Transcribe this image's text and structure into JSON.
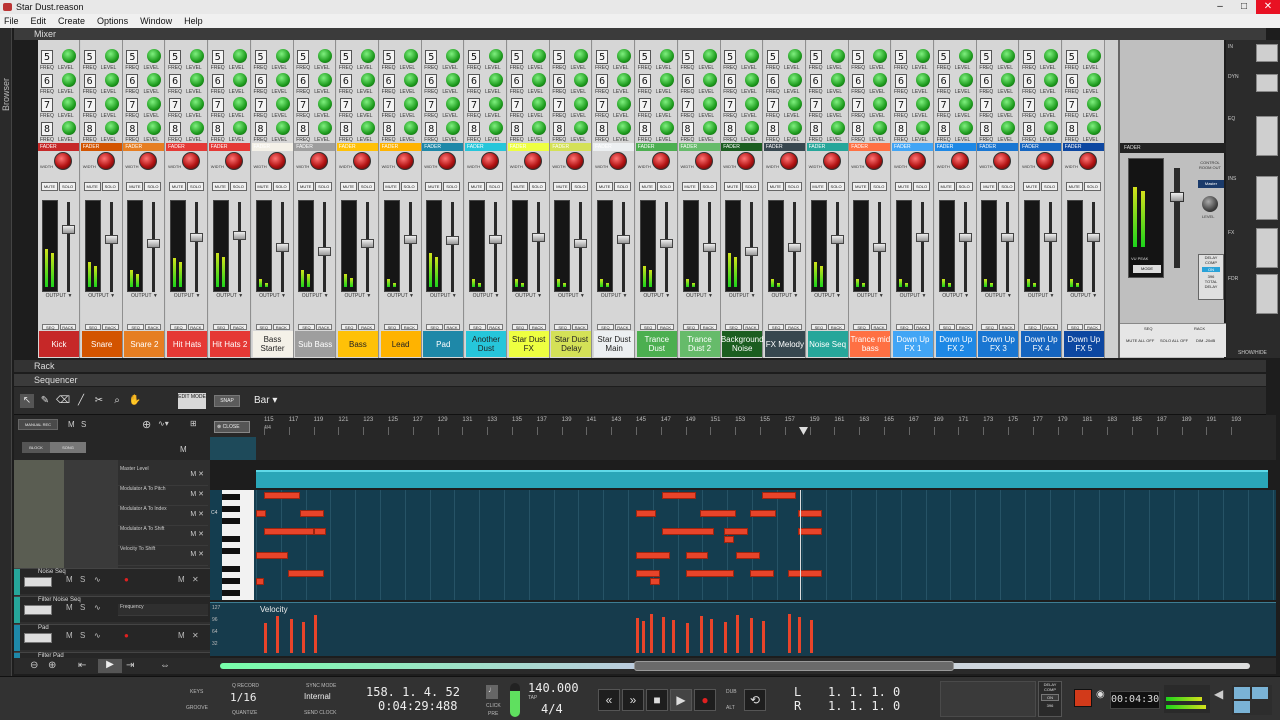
{
  "window": {
    "title": "Star Dust.reason",
    "minimize": "–",
    "maximize": "□",
    "close": "✕"
  },
  "menu": [
    "File",
    "Edit",
    "Create",
    "Options",
    "Window",
    "Help"
  ],
  "browser_label": "Browser",
  "mixer_label": "Mixer",
  "rack_label": "Rack",
  "sequencer_label": "Sequencer",
  "channels": [
    {
      "name": "Kick",
      "color": "#c62828",
      "meter": 0.45,
      "fader": 0.72
    },
    {
      "name": "Snare",
      "color": "#d35400",
      "meter": 0.3,
      "fader": 0.6
    },
    {
      "name": "Snare 2",
      "color": "#e67e22",
      "meter": 0.2,
      "fader": 0.55
    },
    {
      "name": "Hit Hats",
      "color": "#e53935",
      "meter": 0.35,
      "fader": 0.62
    },
    {
      "name": "Hit Hats 2",
      "color": "#e53935",
      "meter": 0.4,
      "fader": 0.65
    },
    {
      "name": "Bass Starter",
      "color": "#f4f1e8",
      "meter": 0.1,
      "fader": 0.5
    },
    {
      "name": "Sub Bass",
      "color": "#9e9e9e",
      "meter": 0.2,
      "fader": 0.45
    },
    {
      "name": "Bass",
      "color": "#ffc107",
      "meter": 0.15,
      "fader": 0.55
    },
    {
      "name": "Lead",
      "color": "#ffb300",
      "meter": 0.1,
      "fader": 0.6
    },
    {
      "name": "Pad",
      "color": "#1e88a8",
      "meter": 0.4,
      "fader": 0.58
    },
    {
      "name": "Another Dust",
      "color": "#26c6da",
      "meter": 0.1,
      "fader": 0.6
    },
    {
      "name": "Star Dust FX",
      "color": "#eeff41",
      "meter": 0.1,
      "fader": 0.62
    },
    {
      "name": "Star Dust Delay",
      "color": "#d4e157",
      "meter": 0.1,
      "fader": 0.55
    },
    {
      "name": "Star Dust Main",
      "color": "#eceff1",
      "meter": 0.1,
      "fader": 0.6
    },
    {
      "name": "Trance Dust",
      "color": "#4caf50",
      "meter": 0.25,
      "fader": 0.55
    },
    {
      "name": "Trance Dust 2",
      "color": "#66bb6a",
      "meter": 0.1,
      "fader": 0.5
    },
    {
      "name": "Background Noise",
      "color": "#1b5e20",
      "meter": 0.4,
      "fader": 0.45
    },
    {
      "name": "FX Melody",
      "color": "#37474f",
      "meter": 0.1,
      "fader": 0.5
    },
    {
      "name": "Noise Seq",
      "color": "#26a69a",
      "meter": 0.3,
      "fader": 0.6
    },
    {
      "name": "Trance mid bass",
      "color": "#ff7043",
      "meter": 0.1,
      "fader": 0.5
    },
    {
      "name": "Down Up FX 1",
      "color": "#42a5f5",
      "meter": 0.1,
      "fader": 0.62
    },
    {
      "name": "Down Up FX 2",
      "color": "#1e88e5",
      "meter": 0.1,
      "fader": 0.62
    },
    {
      "name": "Down Up FX 3",
      "color": "#1976d2",
      "meter": 0.1,
      "fader": 0.62
    },
    {
      "name": "Down Up FX 4",
      "color": "#1565c0",
      "meter": 0.1,
      "fader": 0.62
    },
    {
      "name": "Down Up FX 5",
      "color": "#0d47a1",
      "meter": 0.1,
      "fader": 0.62
    }
  ],
  "strip_labels": {
    "freq": "FREQ",
    "level": "LEVEL",
    "fader": "FADER",
    "width": "WIDTH",
    "mute": "MUTE",
    "solo": "SOLO",
    "output": "OUTPUT ▼",
    "seq": "SEQ",
    "rack": "RACK"
  },
  "fx_numbers": [
    "5",
    "6",
    "7",
    "8"
  ],
  "master": {
    "fader": "FADER",
    "control_room": "CONTROL ROOM OUT",
    "master_btn": "Master",
    "level": "LEVEL",
    "delay_comp": "DELAY COMP",
    "on": "ON",
    "samples": "396",
    "total_delay": "TOTAL DELAY",
    "seq": "SEQ",
    "rack": "RACK",
    "mute_all": "MUTE ALL OFF",
    "solo_all": "SOLO ALL OFF",
    "dim": "DIM -20dB",
    "vu": "VU PEAK",
    "mode": "MODE"
  },
  "right_panel": {
    "labels": [
      "IN",
      "DYN",
      "EQ",
      "INS",
      "FX",
      "FDR"
    ],
    "show_hide": "SHOW/HIDE"
  },
  "seq_toolbar": {
    "edit_mode": "EDIT MODE",
    "snap": "SNAP",
    "snap_value": "Bar"
  },
  "track_header": {
    "manual_rec": "MANUAL REC",
    "block": "BLOCK",
    "song": "SONG",
    "close": "CLOSE",
    "m": "M",
    "s": "S"
  },
  "lanes": [
    "Master Level",
    "Modulator A To Pitch",
    "Modulator A To Index",
    "Modulator A To Shift",
    "Velocity To Shift"
  ],
  "tracks": [
    {
      "name": "Noise Seq",
      "color": "#26a69a"
    },
    {
      "name": "Filter Noise Seq",
      "color": "#26a69a"
    },
    {
      "name": "Pad",
      "color": "#1e88a8"
    },
    {
      "name": "Filter Pad",
      "color": "#1e88a8"
    }
  ],
  "frequency_lane": "Frequency",
  "ruler_bars": [
    "115",
    "117",
    "119",
    "121",
    "123",
    "125",
    "127",
    "129",
    "131",
    "133",
    "135",
    "137",
    "139",
    "141",
    "143",
    "145",
    "147",
    "149",
    "151",
    "153",
    "155",
    "157",
    "159",
    "161",
    "163",
    "165",
    "167",
    "169",
    "171",
    "173",
    "175",
    "177",
    "179",
    "181",
    "183",
    "185",
    "187",
    "189",
    "191",
    "193"
  ],
  "time_sig_marker": "4/4",
  "c4": "C4",
  "velocity_label": "Velocity",
  "velocity_scale": [
    "127",
    "96",
    "64",
    "32"
  ],
  "transport": {
    "keys": "KEYS",
    "groove": "GROOVE",
    "q_record": "Q RECORD",
    "quantize_value": "1/16",
    "quantize": "QUANTIZE",
    "sync_mode": "SYNC MODE",
    "sync_value": "Internal",
    "send_clock": "SEND CLOCK",
    "position_bars": "158. 1. 4. 52",
    "position_time": "0:04:29:488",
    "click": "CLICK",
    "pre": "PRE",
    "tempo": "140.000",
    "tap": "TAP",
    "signature": "4/4",
    "dub": "DUB",
    "alt": "ALT",
    "left_label": "L",
    "right_label": "R",
    "left_loc": "1. 1. 1. 0",
    "right_loc": "1. 1. 1. 0",
    "delay_comp": "DELAY COMP",
    "on": "ON",
    "samples": "396",
    "cpu_display": "00:04:30"
  },
  "colors": {
    "note": "#e8442a",
    "noteBg": "#143d4f",
    "lane": "#2aa6b8"
  }
}
